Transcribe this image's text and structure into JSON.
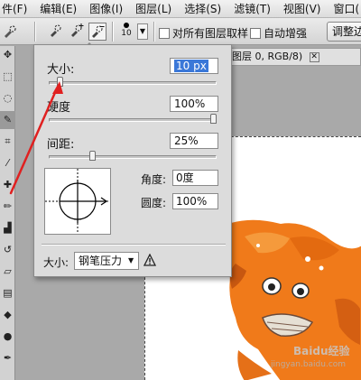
{
  "menu": [
    "件(F)",
    "编辑(E)",
    "图像(I)",
    "图层(L)",
    "选择(S)",
    "滤镜(T)",
    "视图(V)",
    "窗口("
  ],
  "options_bar": {
    "brush_size_label": "10",
    "sample_all_layers_label": "对所有图层取样",
    "auto_enhance_label": "自动增强",
    "adjust_edge_label": "调整边缘"
  },
  "document": {
    "tab_label": "图层 0, RGB/8)",
    "tab_close": "✕"
  },
  "brush_popup": {
    "size_label": "大小:",
    "size_value": "10 px",
    "hardness_label": "硬度",
    "hardness_value": "100%",
    "spacing_label": "间距:",
    "spacing_value": "25%",
    "angle_label": "角度:",
    "angle_value": "0度",
    "roundness_label": "圆度:",
    "roundness_value": "100%",
    "size_control_label": "大小:",
    "size_control_value": "钢笔压力",
    "size_control_arrow": "▼",
    "size_fraction": 0.05,
    "hardness_fraction": 1.0,
    "spacing_fraction": 0.25
  },
  "watermark": {
    "text": "Baidu经验",
    "subtext": "jingyan.baidu.com"
  },
  "colors": {
    "selection_highlight": "#3b78d8",
    "annotation_arrow": "#e02020",
    "crab_orange": "#f07a1a"
  }
}
